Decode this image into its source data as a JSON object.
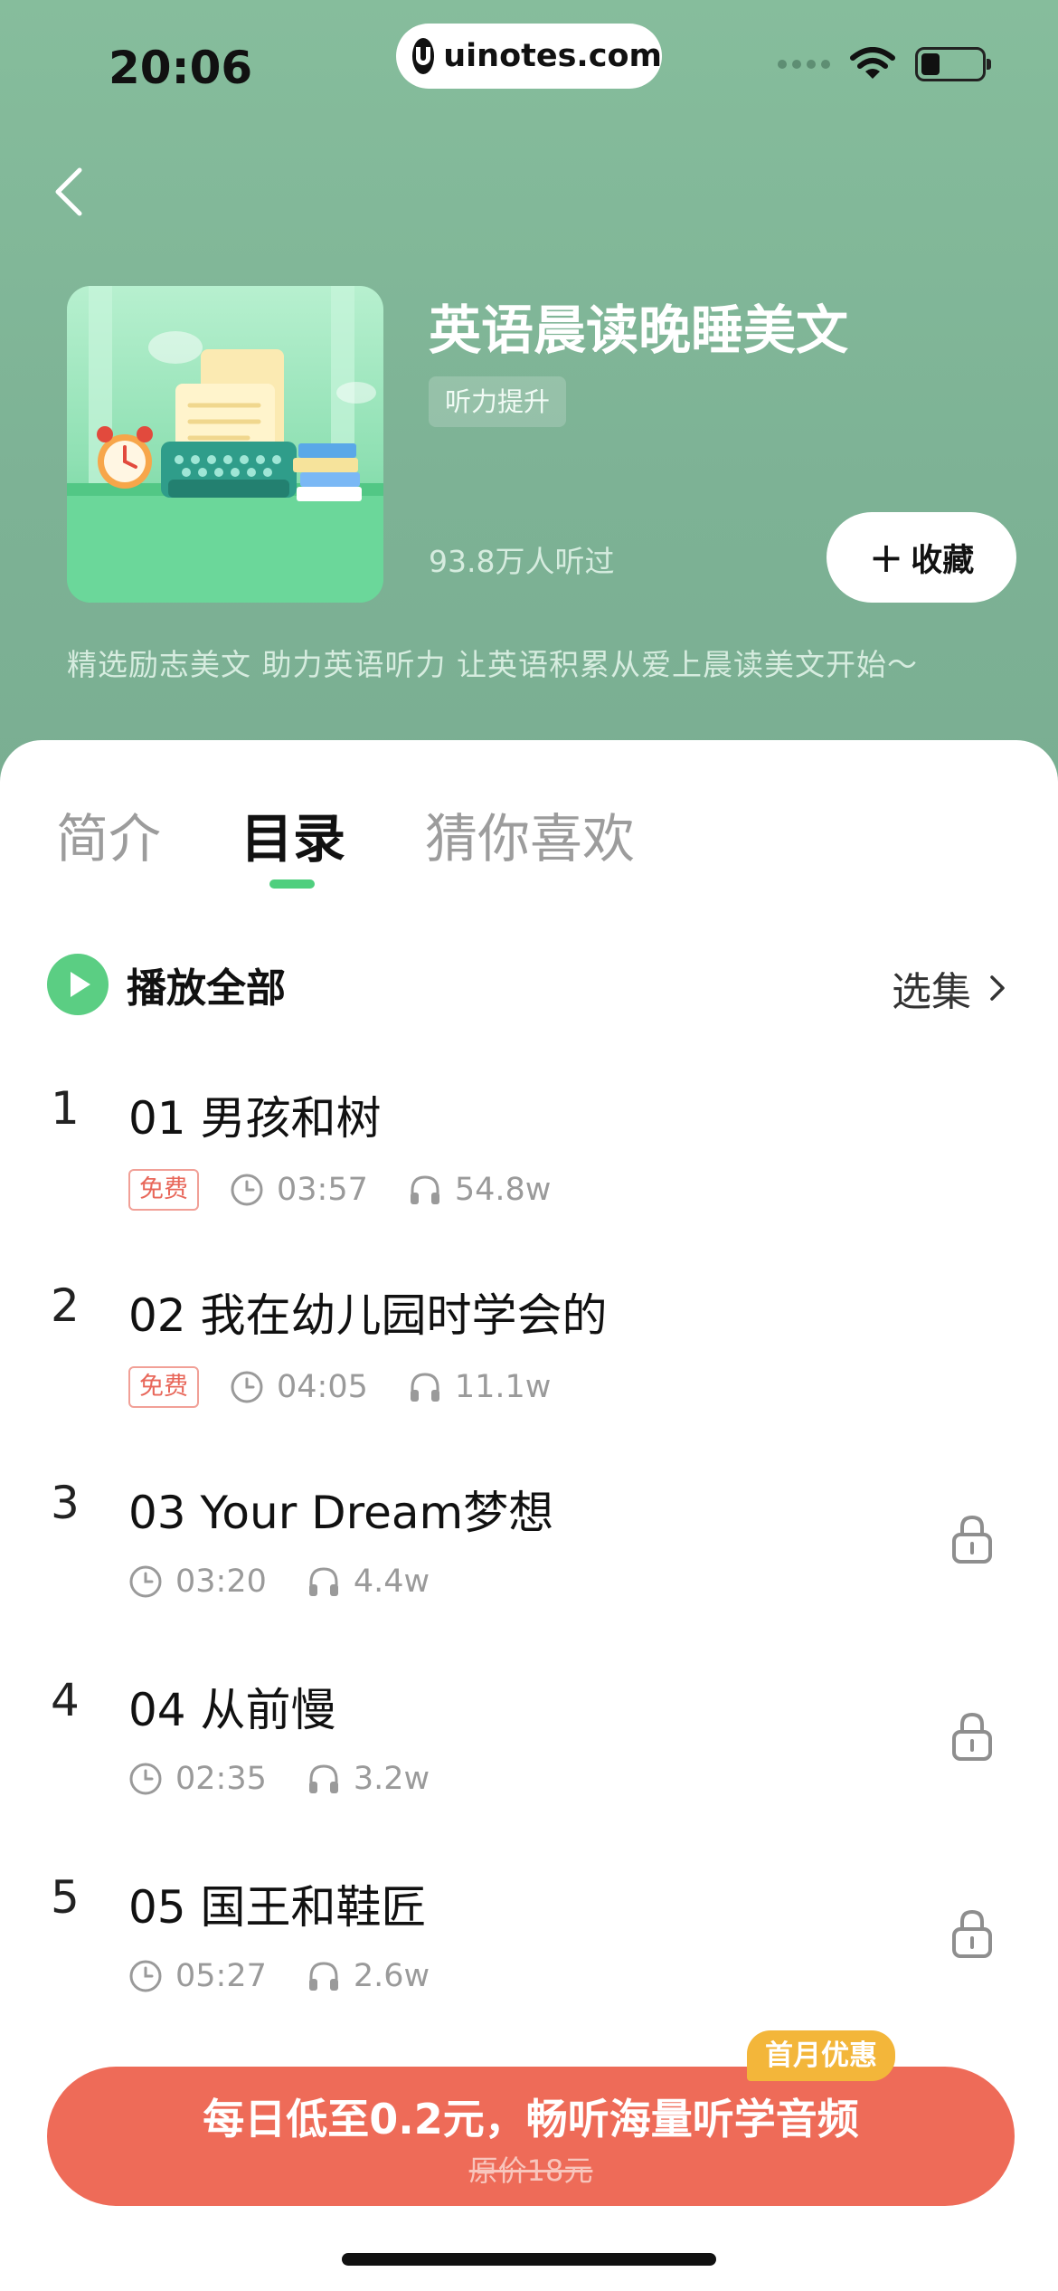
{
  "status_bar": {
    "time": "20:06",
    "url": "uinotes.com"
  },
  "album": {
    "title": "英语晨读晚睡美文",
    "tag": "听力提升",
    "listens": "93.8万人听过",
    "favorite_label": "收藏",
    "description": "精选励志美文 助力英语听力 让英语积累从爱上晨读美文开始～"
  },
  "tabs": [
    {
      "label": "简介",
      "active": false
    },
    {
      "label": "目录",
      "active": true
    },
    {
      "label": "猜你喜欢",
      "active": false
    }
  ],
  "playlist": {
    "play_all_label": "播放全部",
    "select_label": "选集"
  },
  "episodes": [
    {
      "index": "1",
      "title": "01 男孩和树",
      "badge": "免费",
      "duration": "03:57",
      "plays": "54.8w",
      "locked": false
    },
    {
      "index": "2",
      "title": "02 我在幼儿园时学会的",
      "badge": "免费",
      "duration": "04:05",
      "plays": "11.1w",
      "locked": false
    },
    {
      "index": "3",
      "title": "03 Your Dream梦想",
      "badge": "",
      "duration": "03:20",
      "plays": "4.4w",
      "locked": true
    },
    {
      "index": "4",
      "title": "04 从前慢",
      "badge": "",
      "duration": "02:35",
      "plays": "3.2w",
      "locked": true
    },
    {
      "index": "5",
      "title": "05 国王和鞋匠",
      "badge": "",
      "duration": "05:27",
      "plays": "2.6w",
      "locked": true
    }
  ],
  "cta": {
    "promo_badge": "首月优惠",
    "main": "每日低至0.2元，畅听海量听学音频",
    "original_price": "原价18元"
  },
  "colors": {
    "hero_green": "#7fb597",
    "accent_green": "#5bce83",
    "cta_red": "#ee6b58",
    "promo_orange": "#f3b63a"
  }
}
